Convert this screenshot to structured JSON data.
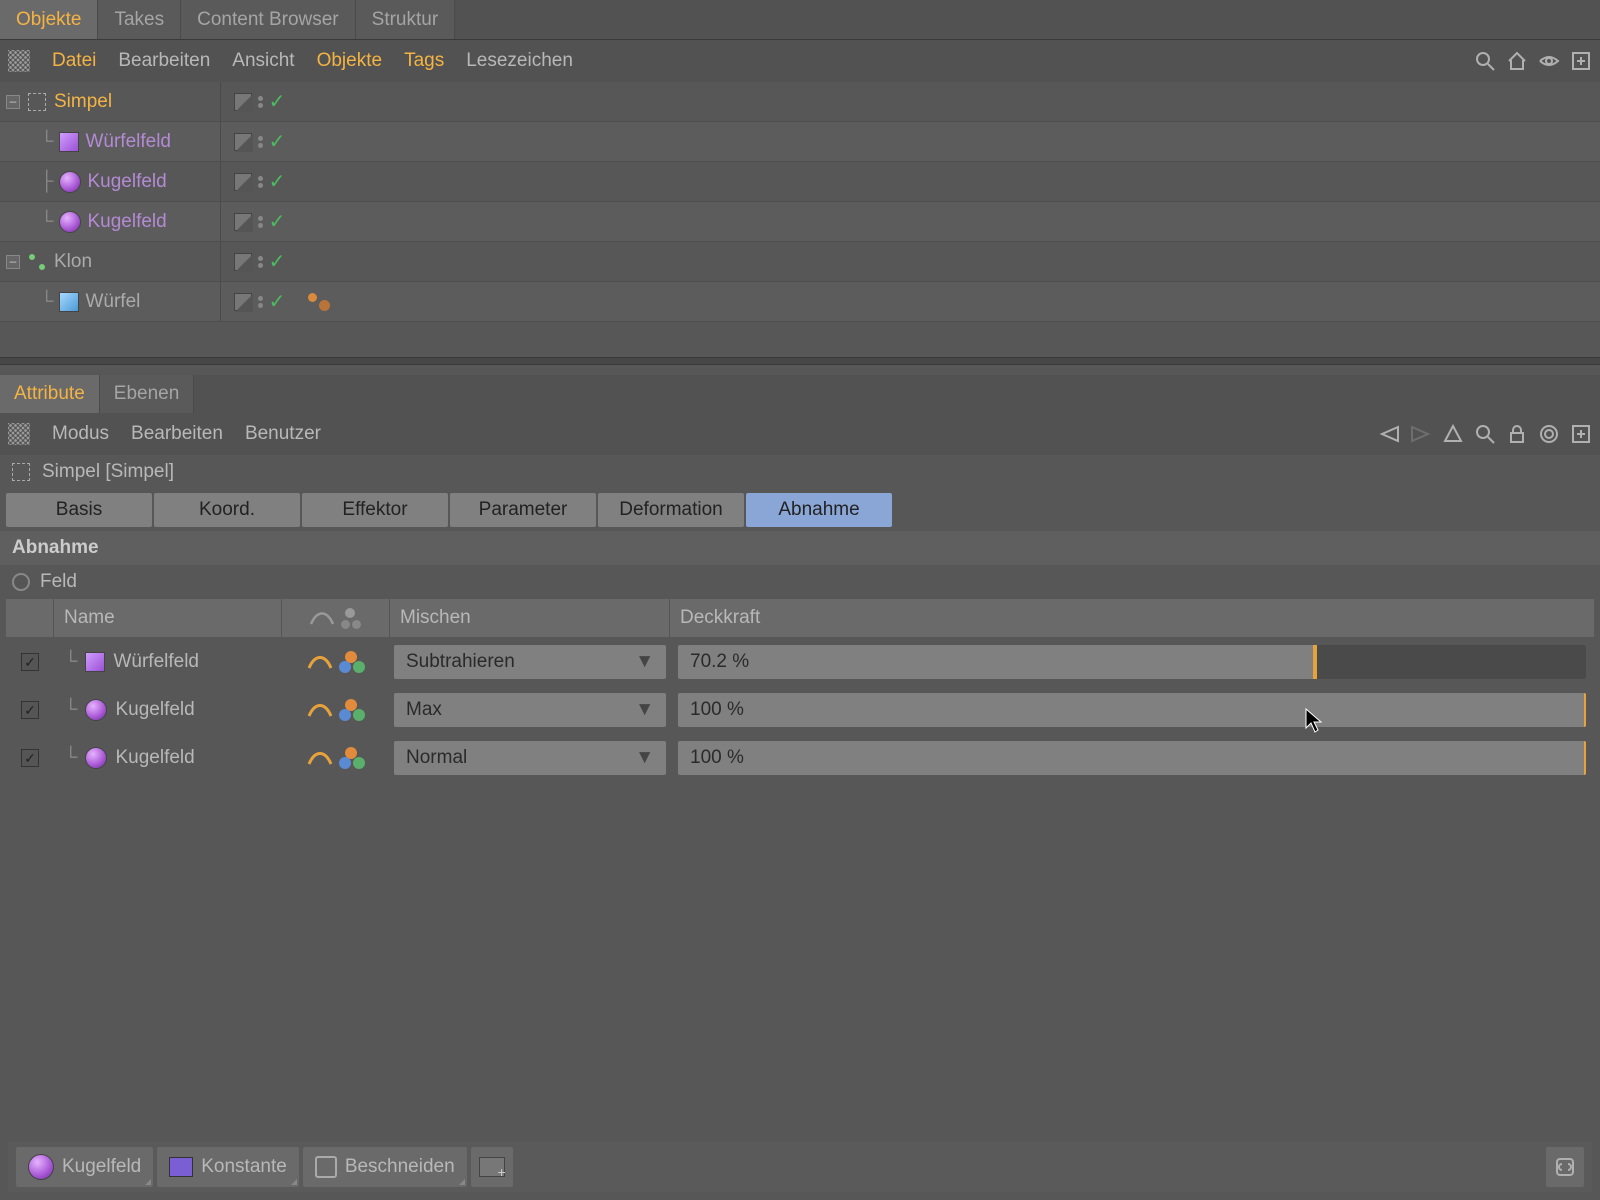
{
  "topTabs": {
    "objects": "Objekte",
    "takes": "Takes",
    "contentBrowser": "Content Browser",
    "structure": "Struktur"
  },
  "topMenu": {
    "file": "Datei",
    "edit": "Bearbeiten",
    "view": "Ansicht",
    "objects": "Objekte",
    "tags": "Tags",
    "bookmarks": "Lesezeichen"
  },
  "tree": {
    "items": [
      {
        "label": "Simpel",
        "selected": true
      },
      {
        "label": "Würfelfeld"
      },
      {
        "label": "Kugelfeld"
      },
      {
        "label": "Kugelfeld"
      },
      {
        "label": "Klon"
      },
      {
        "label": "Würfel"
      }
    ]
  },
  "attrTabs": {
    "attribute": "Attribute",
    "layers": "Ebenen"
  },
  "attrMenu": {
    "mode": "Modus",
    "edit": "Bearbeiten",
    "user": "Benutzer"
  },
  "objectHeader": "Simpel [Simpel]",
  "sectionTabs": {
    "basis": "Basis",
    "koord": "Koord.",
    "effektor": "Effektor",
    "parameter": "Parameter",
    "deformation": "Deformation",
    "abnahme": "Abnahme"
  },
  "sectionTitle": "Abnahme",
  "fieldLabel": "Feld",
  "tableHeaders": {
    "name": "Name",
    "mix": "Mischen",
    "opacity": "Deckkraft"
  },
  "fieldRows": [
    {
      "name": "Würfelfeld",
      "icon": "cube",
      "mix": "Subtrahieren",
      "opacityLabel": "70.2 %",
      "opacityPct": 70.2
    },
    {
      "name": "Kugelfeld",
      "icon": "sphere",
      "mix": "Max",
      "opacityLabel": "100 %",
      "opacityPct": 100
    },
    {
      "name": "Kugelfeld",
      "icon": "sphere",
      "mix": "Normal",
      "opacityLabel": "100 %",
      "opacityPct": 100
    }
  ],
  "bottomBar": {
    "kugelfeld": "Kugelfeld",
    "konstante": "Konstante",
    "beschneiden": "Beschneiden"
  }
}
